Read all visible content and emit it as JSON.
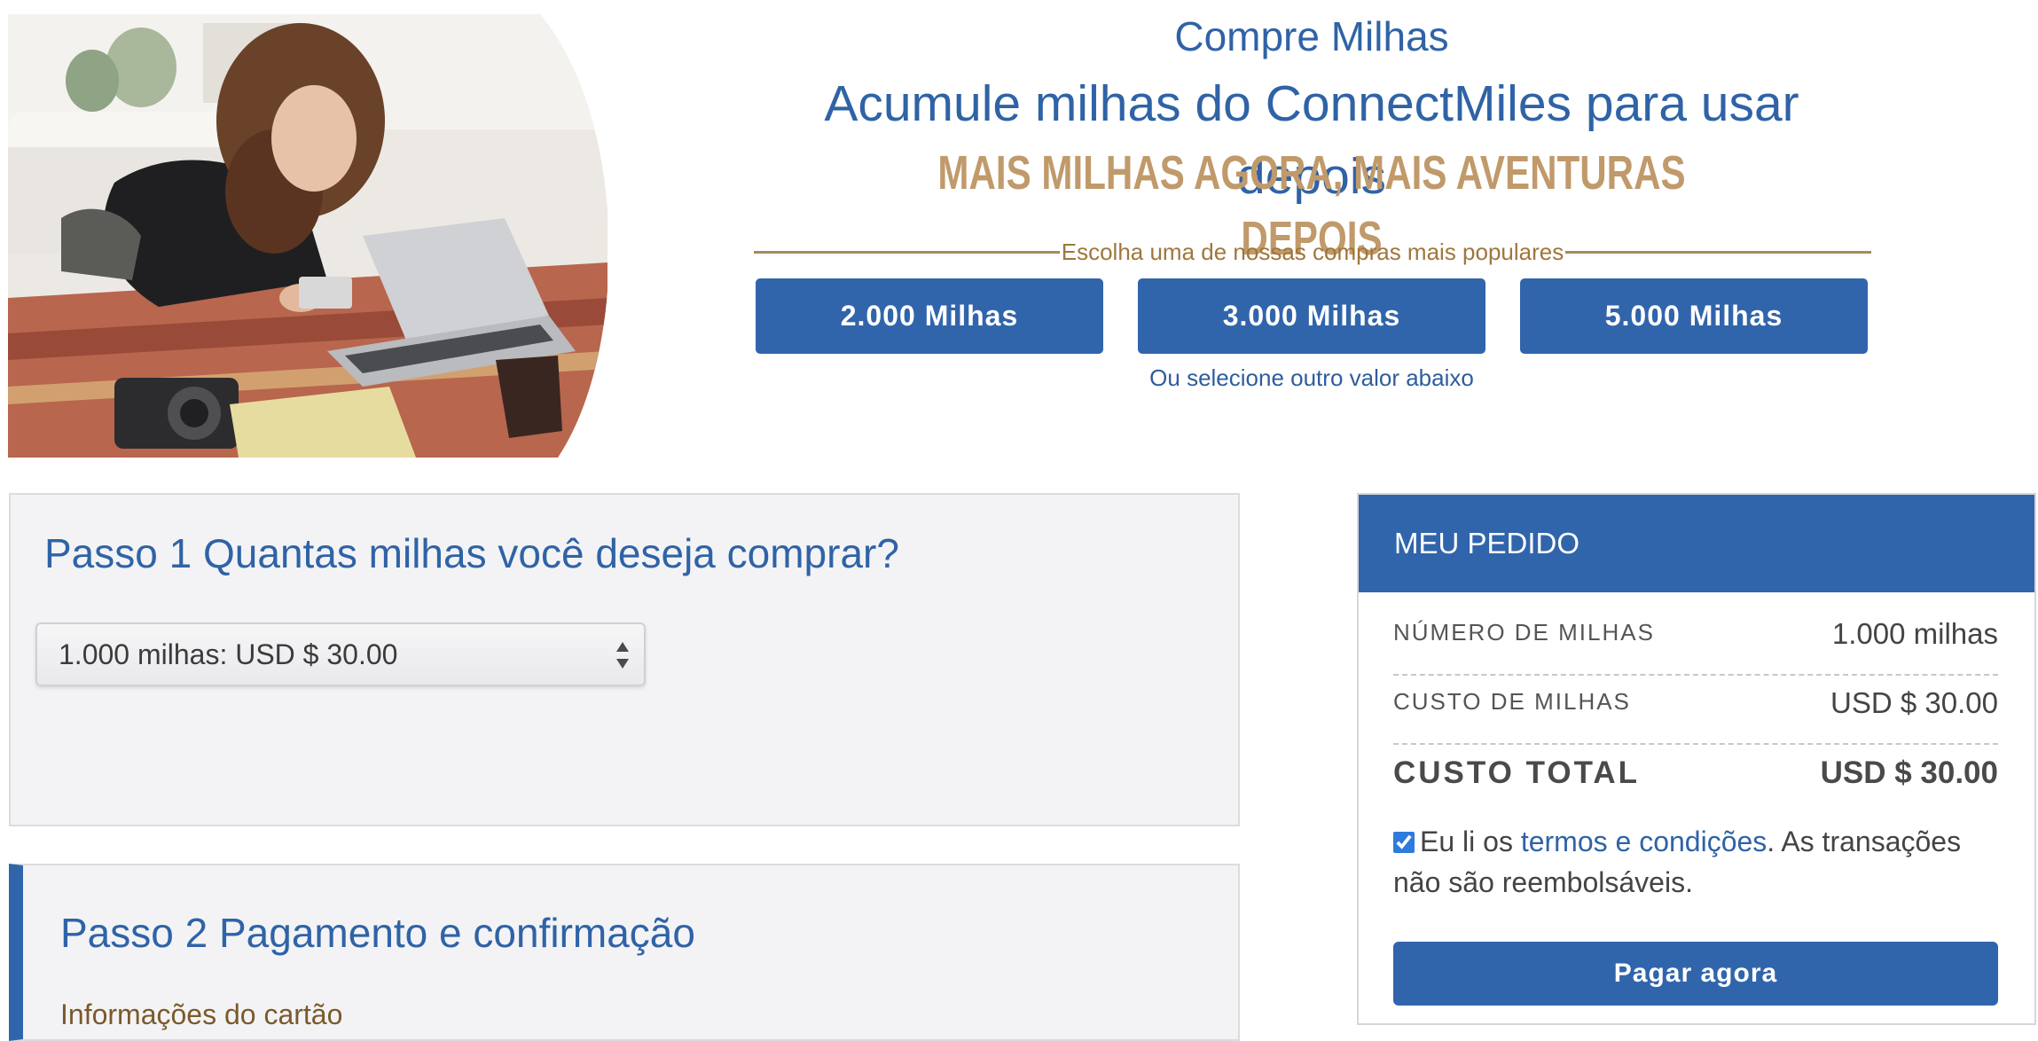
{
  "header": {
    "subtitle": "Compre Milhas",
    "title": "Acumule milhas do ConnectMiles para usar depois",
    "slogan": "MAIS MILHAS AGORA, MAIS AVENTURAS DEPOIS"
  },
  "popular": {
    "label": "Escolha uma de nossas compras mais populares",
    "options": [
      "2.000 Milhas",
      "3.000 Milhas",
      "5.000 Milhas"
    ],
    "other": "Ou selecione outro valor abaixo"
  },
  "step1": {
    "title": "Passo 1 Quantas milhas você deseja comprar?",
    "selected": "1.000 milhas: USD $ 30.00"
  },
  "step2": {
    "title": "Passo 2 Pagamento e confirmação",
    "section": "Informações do cartão"
  },
  "order": {
    "title": "MEU PEDIDO",
    "rows": [
      {
        "label": "NÚMERO DE MILHAS",
        "value": "1.000 milhas"
      },
      {
        "label": "CUSTO DE MILHAS",
        "value": "USD $ 30.00"
      }
    ],
    "total": {
      "label": "CUSTO TOTAL",
      "value": "USD $ 30.00"
    },
    "terms": {
      "checked": true,
      "prefix": "Eu li os",
      "link": "termos e condições",
      "suffix": ". As transações não são reembolsáveis."
    },
    "pay_label": "Pagar agora"
  },
  "colors": {
    "brand_blue": "#3165ab",
    "gold": "#c09a6b",
    "panel_bg": "#f3f3f5"
  },
  "icons": [
    "select-arrows-icon",
    "checkbox-checked-icon"
  ]
}
